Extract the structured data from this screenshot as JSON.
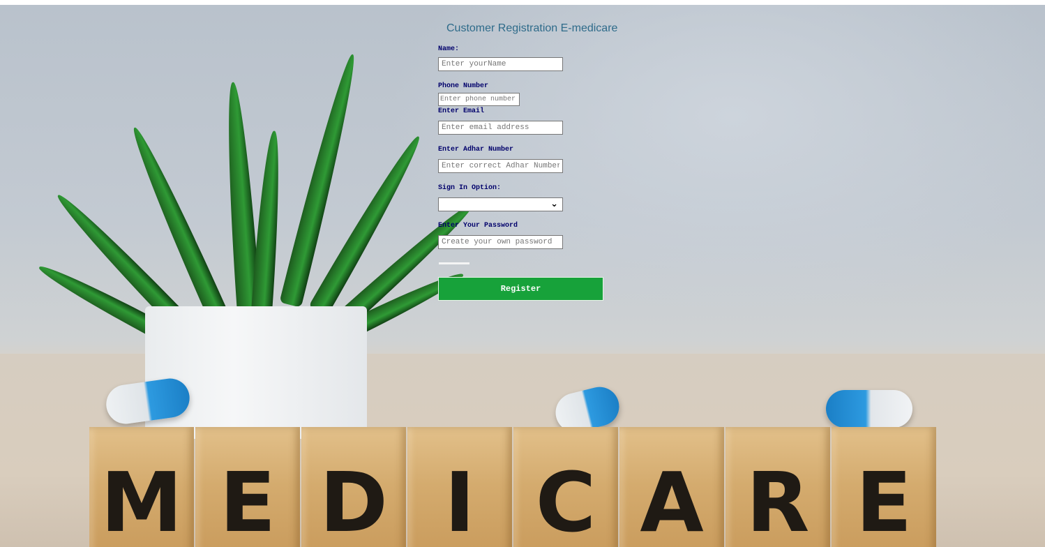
{
  "form": {
    "title": "Customer Registration E-medicare",
    "name_label": "Name:",
    "name_placeholder": "Enter yourName",
    "phone_label": "Phone Number",
    "phone_placeholder": "Enter phone number",
    "email_label": "Enter Email",
    "email_placeholder": "Enter email address",
    "adhar_label": "Enter Adhar Number",
    "adhar_placeholder": "Enter correct Adhar Number",
    "signin_label": "Sign In Option:",
    "signin_selected": "",
    "password_label": "Enter Your Password",
    "password_placeholder": "Create your own password",
    "register_label": "Register"
  },
  "background": {
    "blocks": [
      "M",
      "E",
      "D",
      "I",
      "C",
      "A",
      "R",
      "E"
    ]
  },
  "colors": {
    "title": "#2e6b8a",
    "label": "#00006b",
    "register_button": "#17a23a"
  }
}
